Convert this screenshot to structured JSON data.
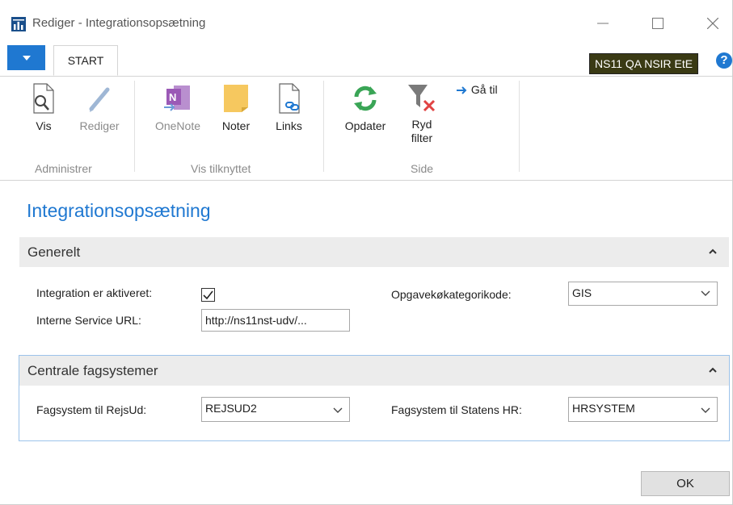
{
  "window": {
    "title": "Rediger - Integrationsopsætning"
  },
  "ribbon": {
    "tab_start": "START",
    "company": "NS11 QA NSIR EtE",
    "help": "?",
    "buttons": {
      "vis": "Vis",
      "rediger": "Rediger",
      "onenote": "OneNote",
      "noter": "Noter",
      "links": "Links",
      "opdater": "Opdater",
      "ryd_line1": "Ryd",
      "ryd_line2": "filter",
      "gaa_til": "Gå til"
    },
    "groups": {
      "administrer": "Administrer",
      "vis_tilknyttet": "Vis tilknyttet",
      "side": "Side"
    }
  },
  "page": {
    "title": "Integrationsopsætning",
    "generelt": {
      "header": "Generelt",
      "integration_label": "Integration er aktiveret:",
      "integration_checked": true,
      "service_url_label": "Interne Service URL:",
      "service_url_value": "http://ns11nst-udv/...",
      "opgave_label": "Opgavekøkategorikode:",
      "opgave_value": "GIS"
    },
    "centrale": {
      "header": "Centrale fagsystemer",
      "rejsud_label": "Fagsystem til RejsUd:",
      "rejsud_value": "REJSUD2",
      "statens_label": "Fagsystem til Statens HR:",
      "statens_value": "HRSYSTEM"
    }
  },
  "footer": {
    "ok": "OK"
  },
  "colors": {
    "accent": "#1f78d1",
    "company_bg": "#3a3a14",
    "header_bg": "#ececec"
  }
}
